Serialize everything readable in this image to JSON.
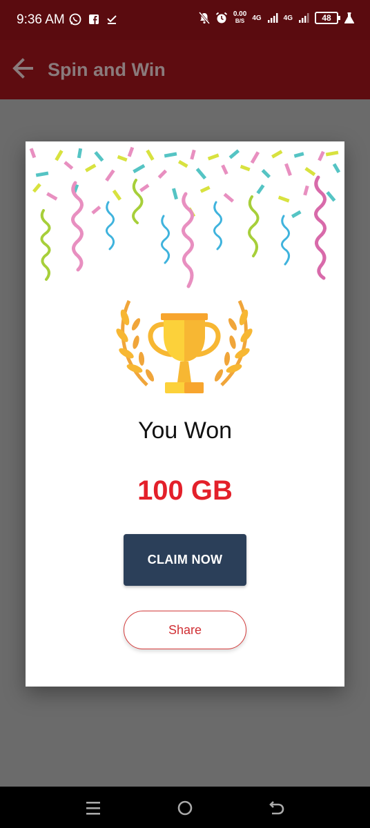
{
  "status_bar": {
    "time": "9:36 AM",
    "net_speed_value": "0.00",
    "net_speed_unit": "B/S",
    "network_1": "4G",
    "network_2": "4G",
    "battery": "48",
    "left_icons": [
      "whatsapp-icon",
      "facebook-icon",
      "download-done-icon"
    ],
    "right_icons": [
      "mute-notifications-icon",
      "alarm-icon",
      "signal-icon",
      "signal-icon",
      "battery-icon",
      "flask-icon"
    ]
  },
  "app_bar": {
    "title": "Spin and Win",
    "back_icon": "arrow-back-icon"
  },
  "dialog": {
    "headline": "You Won",
    "prize": "100 GB",
    "claim_label": "CLAIM NOW",
    "share_label": "Share",
    "image_icons": [
      "confetti-icon",
      "trophy-icon"
    ]
  },
  "colors": {
    "status_bar_bg": "#5a0b0f",
    "app_bar_bg": "#5e0c10",
    "overlay_bg": "#6b6b6b",
    "prize_red": "#e3202a",
    "claim_button_bg": "#2b3f59",
    "share_border": "#d33a3a"
  },
  "nav_bar": {
    "icons": [
      "menu-icon",
      "home-icon",
      "back-icon"
    ]
  }
}
